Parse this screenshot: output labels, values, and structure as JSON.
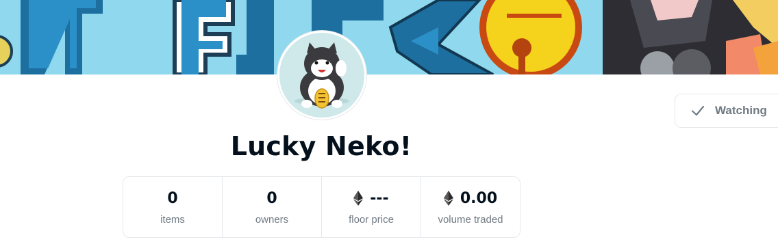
{
  "collection": {
    "name": "Lucky Neko!",
    "banner_icon": "neko-banner-artwork",
    "avatar_icon": "lucky-cat-avatar"
  },
  "watch_button": {
    "label": "Watching",
    "icon": "check-icon"
  },
  "stats": [
    {
      "value": "0",
      "label": "items",
      "currency_icon": null
    },
    {
      "value": "0",
      "label": "owners",
      "currency_icon": null
    },
    {
      "value": "---",
      "label": "floor price",
      "currency_icon": "ethereum-icon"
    },
    {
      "value": "0.00",
      "label": "volume traded",
      "currency_icon": "ethereum-icon"
    }
  ],
  "colors": {
    "banner_sky": "#8fd8ee",
    "text_primary": "#04111d",
    "text_secondary": "#707a83",
    "border": "#e5e8eb"
  }
}
